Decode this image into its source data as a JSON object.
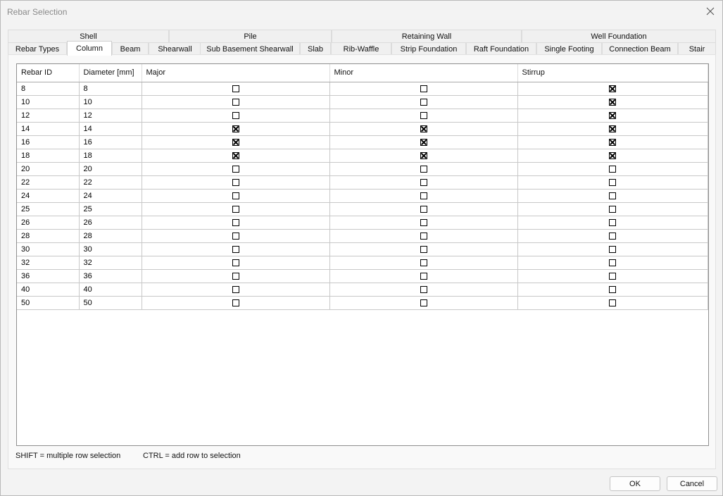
{
  "window": {
    "title": "Rebar Selection"
  },
  "tabs_row1": [
    {
      "label": "Shell"
    },
    {
      "label": "Pile"
    },
    {
      "label": "Retaining Wall"
    },
    {
      "label": "Well Foundation"
    }
  ],
  "tabs_row2": [
    {
      "label": "Rebar Types"
    },
    {
      "label": "Column",
      "active": true
    },
    {
      "label": "Beam"
    },
    {
      "label": "Shearwall"
    },
    {
      "label": "Sub Basement Shearwall"
    },
    {
      "label": "Slab"
    },
    {
      "label": "Rib-Waffle"
    },
    {
      "label": "Strip Foundation"
    },
    {
      "label": "Raft Foundation"
    },
    {
      "label": "Single Footing"
    },
    {
      "label": "Connection Beam"
    },
    {
      "label": "Stair"
    }
  ],
  "table": {
    "columns": [
      "Rebar ID",
      "Diameter [mm]",
      "Major",
      "Minor",
      "Stirrup"
    ],
    "rows": [
      {
        "id": "8",
        "diameter": "8",
        "major": false,
        "minor": false,
        "stirrup": true
      },
      {
        "id": "10",
        "diameter": "10",
        "major": false,
        "minor": false,
        "stirrup": true
      },
      {
        "id": "12",
        "diameter": "12",
        "major": false,
        "minor": false,
        "stirrup": true
      },
      {
        "id": "14",
        "diameter": "14",
        "major": true,
        "minor": true,
        "stirrup": true
      },
      {
        "id": "16",
        "diameter": "16",
        "major": true,
        "minor": true,
        "stirrup": true
      },
      {
        "id": "18",
        "diameter": "18",
        "major": true,
        "minor": true,
        "stirrup": true
      },
      {
        "id": "20",
        "diameter": "20",
        "major": false,
        "minor": false,
        "stirrup": false
      },
      {
        "id": "22",
        "diameter": "22",
        "major": false,
        "minor": false,
        "stirrup": false
      },
      {
        "id": "24",
        "diameter": "24",
        "major": false,
        "minor": false,
        "stirrup": false
      },
      {
        "id": "25",
        "diameter": "25",
        "major": false,
        "minor": false,
        "stirrup": false
      },
      {
        "id": "26",
        "diameter": "26",
        "major": false,
        "minor": false,
        "stirrup": false
      },
      {
        "id": "28",
        "diameter": "28",
        "major": false,
        "minor": false,
        "stirrup": false
      },
      {
        "id": "30",
        "diameter": "30",
        "major": false,
        "minor": false,
        "stirrup": false
      },
      {
        "id": "32",
        "diameter": "32",
        "major": false,
        "minor": false,
        "stirrup": false
      },
      {
        "id": "36",
        "diameter": "36",
        "major": false,
        "minor": false,
        "stirrup": false
      },
      {
        "id": "40",
        "diameter": "40",
        "major": false,
        "minor": false,
        "stirrup": false
      },
      {
        "id": "50",
        "diameter": "50",
        "major": false,
        "minor": false,
        "stirrup": false
      }
    ]
  },
  "hints": {
    "shift": "SHIFT = multiple row selection",
    "ctrl": "CTRL = add row to selection"
  },
  "buttons": {
    "ok": "OK",
    "cancel": "Cancel"
  },
  "colors": {
    "border": "#b9b9b9",
    "background": "#f3f3f3",
    "title_text": "#8a8a8a"
  }
}
